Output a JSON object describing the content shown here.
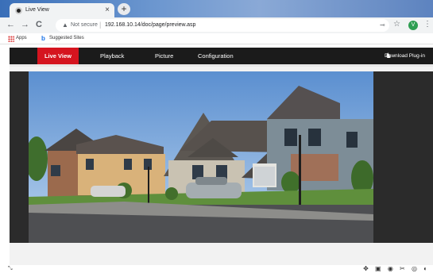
{
  "browser": {
    "tab_title": "Live View",
    "tab_close": "×",
    "newtab": "+",
    "back": "←",
    "forward": "→",
    "reload": "C",
    "not_secure": "Not secure",
    "url": "192.168.10.14/doc/page/preview.asp",
    "avatar_initial": "V",
    "menu": "⋮"
  },
  "bookmarks": {
    "apps": "Apps",
    "suggested": "Suggested Sites"
  },
  "app_nav": {
    "items": [
      "Live View",
      "Playback",
      "Picture",
      "Configuration"
    ],
    "download": "Download Plug-in"
  },
  "bottom": {
    "toolbar": "✥ ▣ ◉ ✂ ◎ ◐"
  },
  "colors": {
    "accent": "#d5141f",
    "nav_bg": "#1b1b1b"
  }
}
